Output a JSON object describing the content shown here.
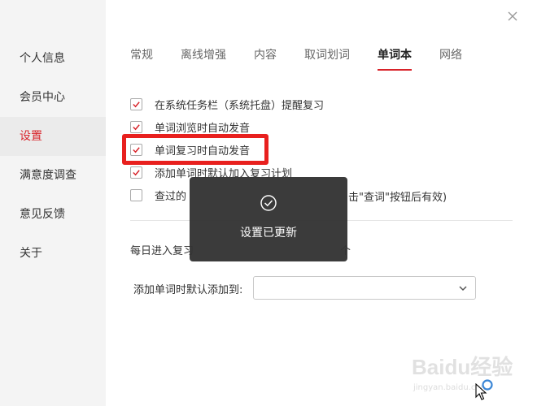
{
  "sidebar": {
    "items": [
      {
        "label": "个人信息"
      },
      {
        "label": "会员中心"
      },
      {
        "label": "设置"
      },
      {
        "label": "满意度调查"
      },
      {
        "label": "意见反馈"
      },
      {
        "label": "关于"
      }
    ]
  },
  "tabs": [
    {
      "label": "常规"
    },
    {
      "label": "离线增强"
    },
    {
      "label": "内容"
    },
    {
      "label": "取词划词"
    },
    {
      "label": "单词本"
    },
    {
      "label": "网络"
    }
  ],
  "options": [
    {
      "label": "在系统任务栏（系统托盘）提醒复习",
      "checked": true
    },
    {
      "label": "单词浏览时自动发音",
      "checked": true
    },
    {
      "label": "单词复习时自动发音",
      "checked": true
    },
    {
      "label": "添加单词时默认加入复习计划",
      "checked": true
    },
    {
      "label_start": "查过的",
      "label_end": "击\"查词\"按钮后有效)",
      "checked": false
    }
  ],
  "daily_review": {
    "label_start": "每日进入复习",
    "label_end": "个"
  },
  "default_add": {
    "label": "添加单词时默认添加到:",
    "value": ""
  },
  "toast": {
    "message": "设置已更新"
  },
  "watermark": {
    "logo": "Baidu经验",
    "url": "jingyan.baidu.com"
  },
  "colors": {
    "accent": "#d8232a",
    "highlight_box": "#e8201e",
    "toast_bg": "#333333"
  },
  "icons": {
    "close": "close-icon",
    "check": "check-icon",
    "toast": "check-circle-icon",
    "dropdown": "chevron-down-icon"
  }
}
